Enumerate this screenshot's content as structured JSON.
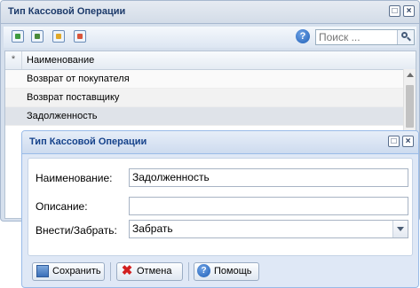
{
  "list_window": {
    "title": "Тип Кассовой Операции",
    "toolbar": {
      "icons": [
        "add-record-icon",
        "edit-record-icon",
        "copy-record-icon",
        "delete-record-icon"
      ],
      "help_icon": "help-icon",
      "search_placeholder": "Поиск ..."
    },
    "grid": {
      "marker_header": "*",
      "column_header": "Наименование",
      "rows": [
        "Возврат от покупателя",
        "Возврат поставщику",
        "Задолженность"
      ],
      "selected_row": 2
    }
  },
  "dialog": {
    "title": "Тип Кассовой Операции",
    "fields": {
      "name_label": "Наименование:",
      "name_value": "Задолженность",
      "description_label": "Описание:",
      "description_value": "",
      "direction_label": "Внести/Забрать:",
      "direction_value": "Забрать"
    },
    "buttons": {
      "save": "Сохранить",
      "cancel": "Отмена",
      "help": "Помощь"
    }
  },
  "colors": {
    "title_text": "#15428b",
    "window_bg": "#dfe8f6",
    "selected_row_bg": "#dfe3e9",
    "alt_row_bg": "#fafafa"
  }
}
